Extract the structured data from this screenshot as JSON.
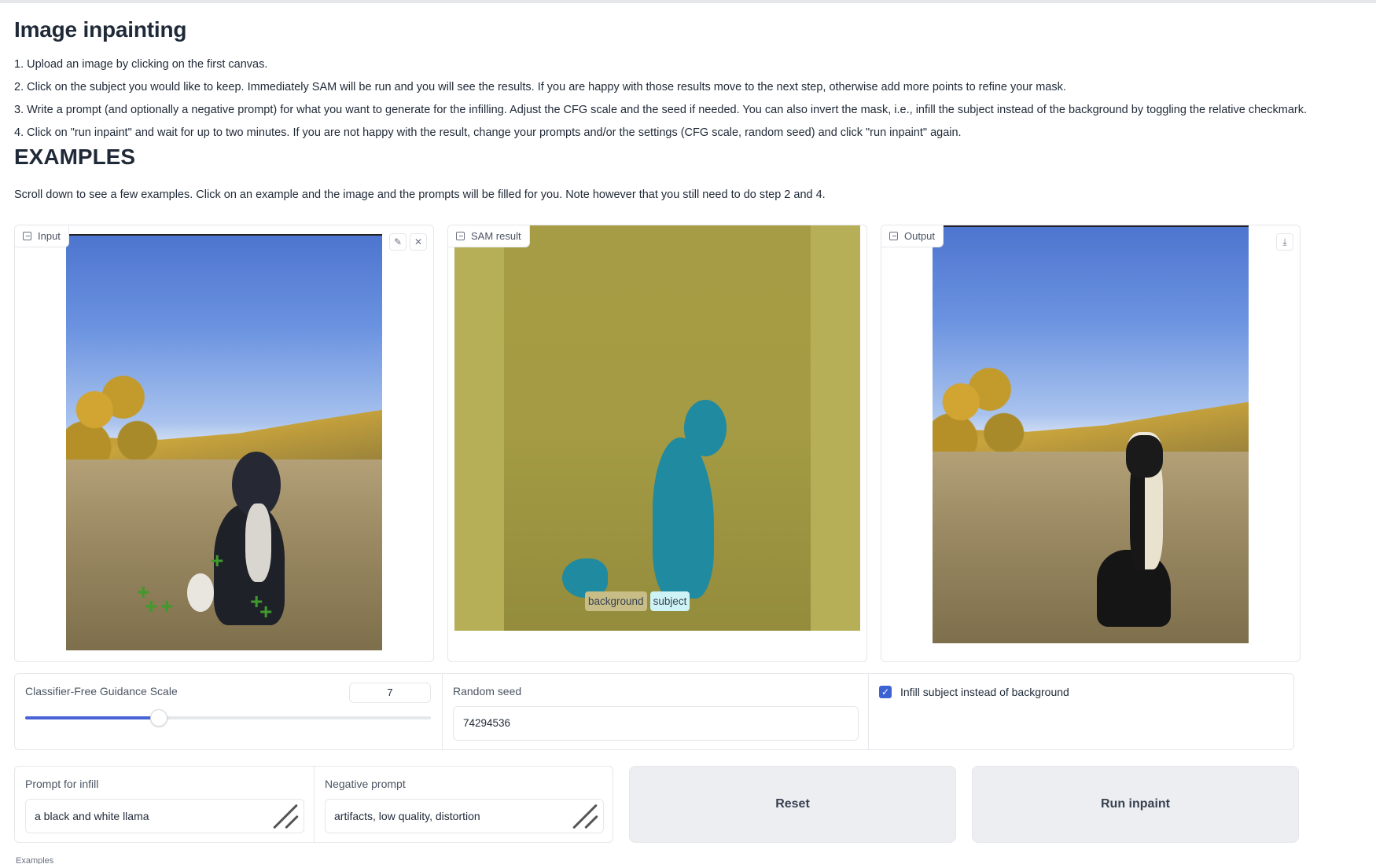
{
  "header": {
    "title": "Image inpainting",
    "steps": [
      "1. Upload an image by clicking on the first canvas.",
      "2. Click on the subject you would like to keep. Immediately SAM will be run and you will see the results. If you are happy with those results move to the next step, otherwise add more points to refine your mask.",
      "3. Write a prompt (and optionally a negative prompt) for what you want to generate for the infilling. Adjust the CFG scale and the seed if needed. You can also invert the mask, i.e., infill the subject instead of the background by toggling the relative checkmark.",
      "4. Click on \"run inpaint\" and wait for up to two minutes. If you are not happy with the result, change your prompts and/or the settings (CFG scale, random seed) and click \"run inpaint\" again."
    ],
    "examples_heading": "EXAMPLES",
    "examples_note": "Scroll down to see a few examples. Click on an example and the image and the prompts will be filled for you. Note however that you still need to do step 2 and 4."
  },
  "panels": {
    "input": {
      "label": "Input",
      "icon": "image-icon",
      "edit_icon": "pencil-icon",
      "clear_icon": "close-icon"
    },
    "sam": {
      "label": "SAM result",
      "icon": "image-icon",
      "legend": [
        "background",
        "subject"
      ],
      "colors": {
        "background": "#c8bd86",
        "subject": "#cdf3f7",
        "mask_subject": "#1f8aa0",
        "mask_background": "#aea646"
      }
    },
    "output": {
      "label": "Output",
      "icon": "image-icon",
      "download_icon": "download-icon"
    }
  },
  "controls": {
    "cfg": {
      "label": "Classifier-Free Guidance Scale",
      "value": "7",
      "slider_fraction": 0.33
    },
    "seed": {
      "label": "Random seed",
      "value": "74294536"
    },
    "infill": {
      "label": "Infill subject instead of background",
      "checked": true
    }
  },
  "prompts": {
    "infill": {
      "label": "Prompt for infill",
      "value": "a black and white llama"
    },
    "negative": {
      "label": "Negative prompt",
      "value": "artifacts, low quality, distortion"
    }
  },
  "buttons": {
    "reset": "Reset",
    "run": "Run inpaint"
  },
  "footer": {
    "examples_label": "Examples"
  },
  "theme": {
    "accent": "#4763d6",
    "button_bg": "#eceef1"
  }
}
